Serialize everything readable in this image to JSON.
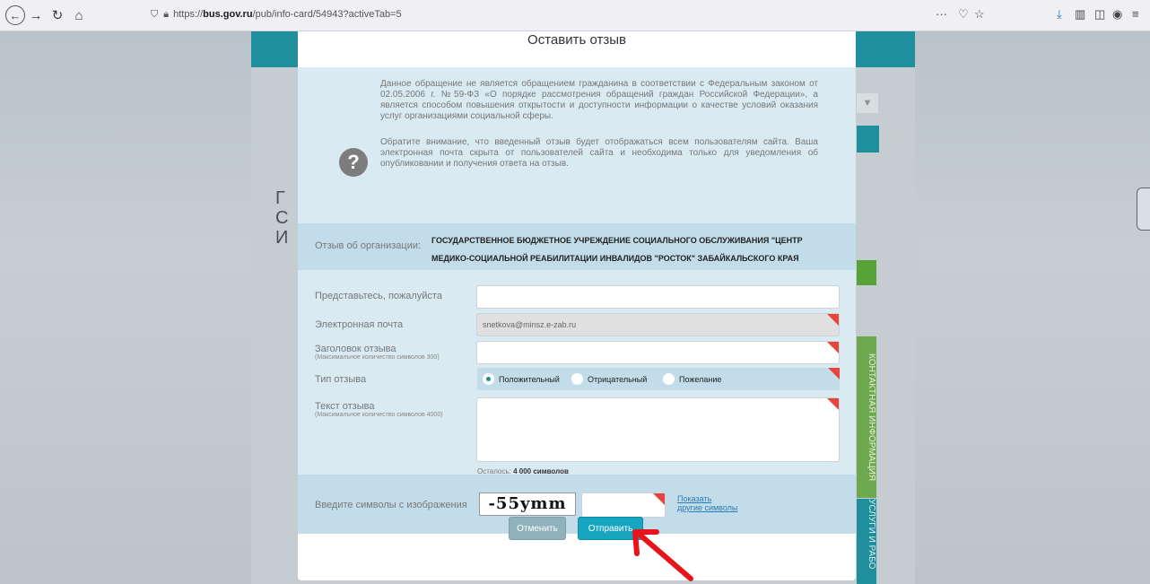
{
  "browser": {
    "url_prefix": "https://",
    "url_host": "bus.gov.ru",
    "url_path": "/pub/info-card/54943?activeTab=5",
    "more_label": "···"
  },
  "background": {
    "letters": [
      "Г",
      "С",
      "И"
    ]
  },
  "side_tabs": {
    "contacts": "КОНТАКТНАЯ ИНФОРМАЦИЯ",
    "services": "УСЛУГИ И РАБО"
  },
  "modal": {
    "title": "Оставить отзыв",
    "info_icon": "question-icon",
    "info_p1": "Данное обращение не является обращением гражданина в соответствии с Федеральным законом от 02.05.2006 г. №59-ФЗ «О порядке рассмотрения обращений граждан Российской Федерации», а является способом повышения открытости и доступности информации о качестве условий оказания услуг организациями социальной сферы.",
    "info_p2": "Обратите внимание, что введенный отзыв будет отображаться всем пользователям сайта. Ваша электронная почта скрыта от пользователей сайта и необходима только для уведомления об опубликовании и получения ответа на отзыв.",
    "org_label": "Отзыв об организации:",
    "org_name": "ГОСУДАРСТВЕННОЕ БЮДЖЕТНОЕ УЧРЕЖДЕНИЕ СОЦИАЛЬНОГО ОБСЛУЖИВАНИЯ \"ЦЕНТР МЕДИКО-СОЦИАЛЬНОЙ РЕАБИЛИТАЦИИ ИНВАЛИДОВ \"РОСТОК\" ЗАБАЙКАЛЬСКОГО КРАЯ",
    "form": {
      "name_label": "Представьтесь, пожалуйста",
      "name_value": "",
      "email_label": "Электронная почта",
      "email_value": "snetkova@minsz.e-zab.ru",
      "title_label": "Заголовок отзыва",
      "title_hint": "(Максимальное количество символов 300)",
      "title_value": "",
      "type_label": "Тип отзыва",
      "type_options": [
        "Положительный",
        "Отрицательный",
        "Пожелание"
      ],
      "type_selected": "Положительный",
      "text_label": "Текст отзыва",
      "text_hint": "(Максимальное количество символов 4000)",
      "text_value": "",
      "remaining_prefix": "Осталось:",
      "remaining_value": "4 000 символов"
    },
    "captcha": {
      "label": "Введите символы с изображения",
      "image_text": "-55ymm",
      "input_value": "",
      "link_line1": "Показать",
      "link_line2": "другие символы"
    },
    "buttons": {
      "cancel": "Отменить",
      "send": "Отправить"
    }
  },
  "annotation": {
    "arrow_color": "#e8141c"
  }
}
